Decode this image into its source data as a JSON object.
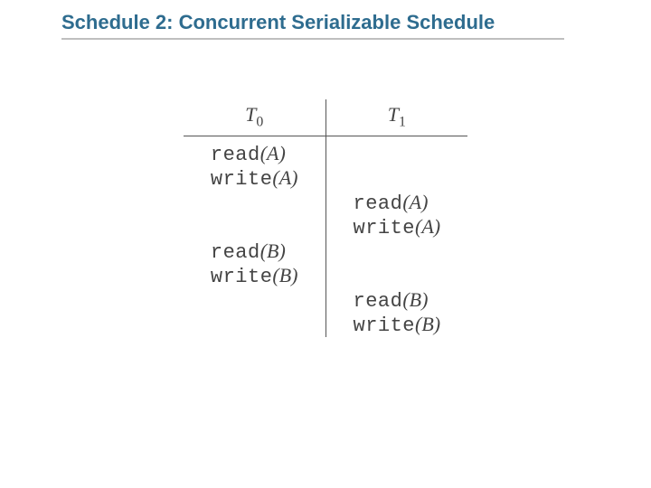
{
  "title": "Schedule 2: Concurrent Serializable Schedule",
  "headers": {
    "t0_base": "T",
    "t0_sub": "0",
    "t1_base": "T",
    "t1_sub": "1"
  },
  "ops": {
    "r1_c0_name": "read",
    "r1_c0_arg": "(A)",
    "r1_c1_name": "",
    "r1_c1_arg": "",
    "r2_c0_name": "write",
    "r2_c0_arg": "(A)",
    "r2_c1_name": "",
    "r2_c1_arg": "",
    "r3_c0_name": "",
    "r3_c0_arg": "",
    "r3_c1_name": "read",
    "r3_c1_arg": "(A)",
    "r4_c0_name": "",
    "r4_c0_arg": "",
    "r4_c1_name": "write",
    "r4_c1_arg": "(A)",
    "r5_c0_name": "read",
    "r5_c0_arg": "(B)",
    "r5_c1_name": "",
    "r5_c1_arg": "",
    "r6_c0_name": "write",
    "r6_c0_arg": "(B)",
    "r6_c1_name": "",
    "r6_c1_arg": "",
    "r7_c0_name": "",
    "r7_c0_arg": "",
    "r7_c1_name": "read",
    "r7_c1_arg": "(B)",
    "r8_c0_name": "",
    "r8_c0_arg": "",
    "r8_c1_name": "write",
    "r8_c1_arg": "(B)"
  },
  "chart_data": {
    "type": "table",
    "title": "Concurrent Serializable Schedule",
    "columns": [
      "T0",
      "T1"
    ],
    "rows": [
      [
        "read(A)",
        ""
      ],
      [
        "write(A)",
        ""
      ],
      [
        "",
        "read(A)"
      ],
      [
        "",
        "write(A)"
      ],
      [
        "read(B)",
        ""
      ],
      [
        "write(B)",
        ""
      ],
      [
        "",
        "read(B)"
      ],
      [
        "",
        "write(B)"
      ]
    ]
  }
}
